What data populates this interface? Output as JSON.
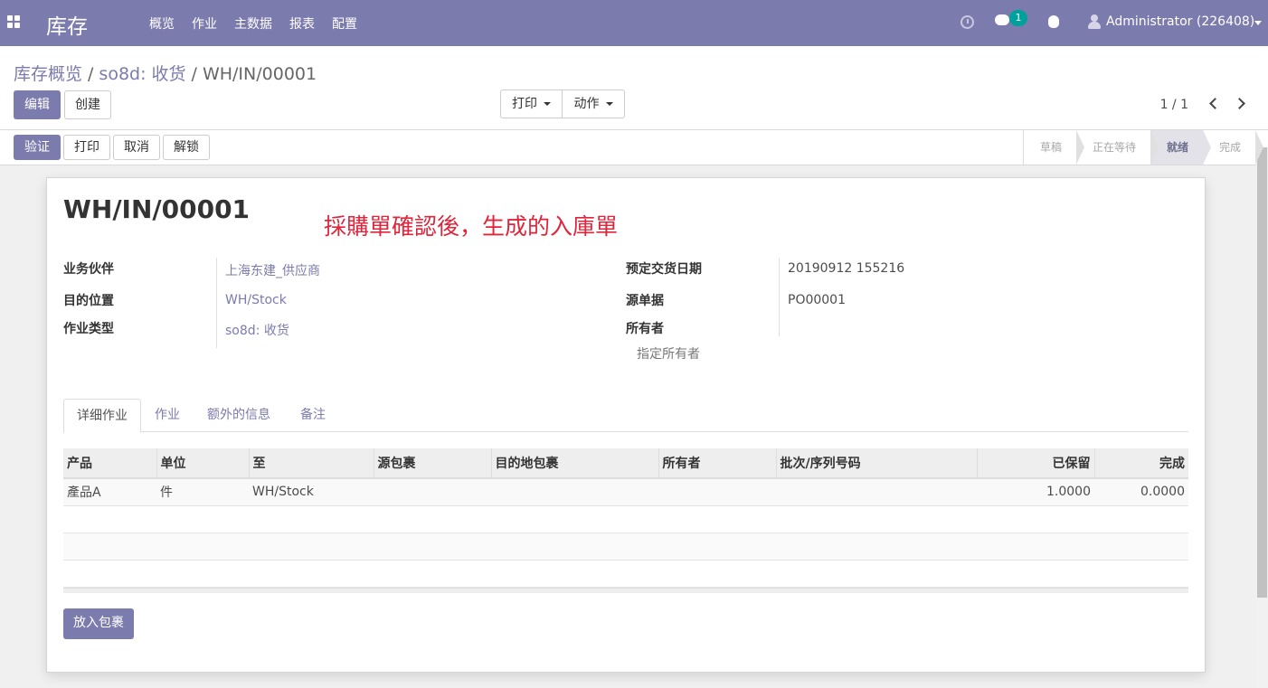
{
  "app": {
    "brand": "库存",
    "menu": [
      "概览",
      "作业",
      "主数据",
      "报表",
      "配置"
    ]
  },
  "systray": {
    "message_count": "1",
    "user": "Administrator (226408)"
  },
  "breadcrumb": {
    "items": [
      "库存概览",
      "so8d: 收货"
    ],
    "current": "WH/IN/00001"
  },
  "control": {
    "edit": "编辑",
    "create": "创建",
    "print": "打印",
    "action": "动作",
    "pager": "1 / 1"
  },
  "status_buttons": {
    "validate": "验证",
    "print": "打印",
    "cancel": "取消",
    "unlock": "解锁"
  },
  "stages": [
    "草稿",
    "正在等待",
    "就绪",
    "完成"
  ],
  "active_stage": "就绪",
  "record": {
    "name": "WH/IN/00001",
    "annotation": "採購單確認後，生成的入庫單",
    "fields": {
      "partner_label": "业务伙伴",
      "partner": "上海东建_供应商",
      "dest_label": "目的位置",
      "dest": "WH/Stock",
      "type_label": "作业类型",
      "type": "so8d: 收货",
      "date_label": "预定交货日期",
      "date": "20190912 155216",
      "origin_label": "源单据",
      "origin": "PO00001",
      "owner_label": "所有者",
      "owner_placeholder": "指定所有者"
    }
  },
  "tabs": [
    "详细作业",
    "作业",
    "额外的信息",
    "备注"
  ],
  "grid": {
    "headers": [
      "产品",
      "单位",
      "至",
      "源包裹",
      "目的地包裹",
      "所有者",
      "批次/序列号码",
      "已保留",
      "完成"
    ],
    "rows": [
      {
        "product": "產品A",
        "uom": "件",
        "to": "WH/Stock",
        "reserved": "1.0000",
        "done": "0.0000"
      }
    ]
  },
  "put_in_pack": "放入包裹",
  "colors": {
    "brand": "#7c7bad",
    "annotation": "#e0253b",
    "badge": "#00a09d"
  }
}
